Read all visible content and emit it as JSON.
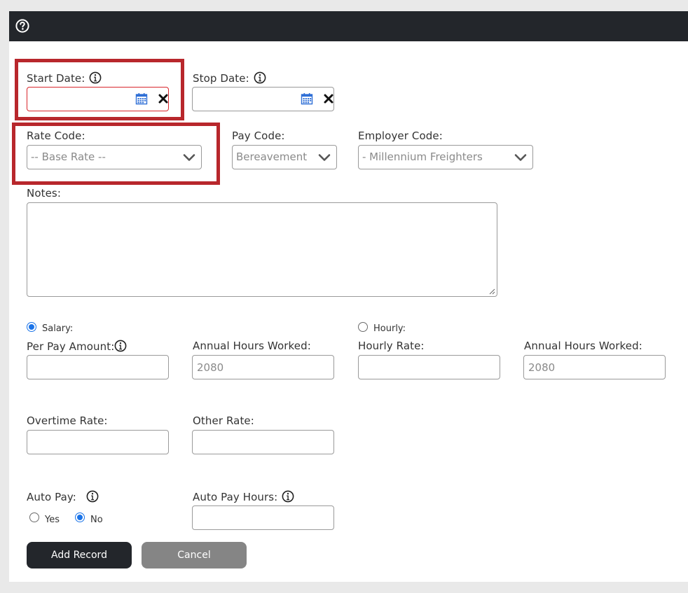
{
  "form": {
    "start_date": {
      "label": "Start Date:",
      "value": ""
    },
    "stop_date": {
      "label": "Stop Date:",
      "value": ""
    },
    "rate_code": {
      "label": "Rate Code:",
      "selected": "-- Base Rate --"
    },
    "pay_code": {
      "label": "Pay Code:",
      "selected": "Bereavement"
    },
    "employer_code": {
      "label": "Employer Code:",
      "selected": "- Millennium Freighters"
    },
    "notes": {
      "label": "Notes:",
      "value": ""
    },
    "salary": {
      "option_label": "Salary:",
      "checked": true,
      "per_pay_amount_label": "Per Pay Amount:",
      "per_pay_amount_value": "",
      "annual_hours_label": "Annual Hours Worked:",
      "annual_hours_placeholder": "2080"
    },
    "hourly": {
      "option_label": "Hourly:",
      "checked": false,
      "hourly_rate_label": "Hourly Rate:",
      "hourly_rate_value": "",
      "annual_hours_label": "Annual Hours Worked:",
      "annual_hours_placeholder": "2080"
    },
    "overtime_rate": {
      "label": "Overtime Rate:",
      "value": ""
    },
    "other_rate": {
      "label": "Other Rate:",
      "value": ""
    },
    "auto_pay": {
      "label": "Auto Pay:",
      "yes_label": "Yes",
      "no_label": "No",
      "selected": "No"
    },
    "auto_pay_hours": {
      "label": "Auto Pay Hours:",
      "value": ""
    }
  },
  "actions": {
    "add_label": "Add Record",
    "cancel_label": "Cancel"
  },
  "colors": {
    "topbar": "#23262b",
    "highlight": "#b8272c",
    "radio_accent": "#1a73e8",
    "calendar_icon": "#2f6fd6"
  }
}
